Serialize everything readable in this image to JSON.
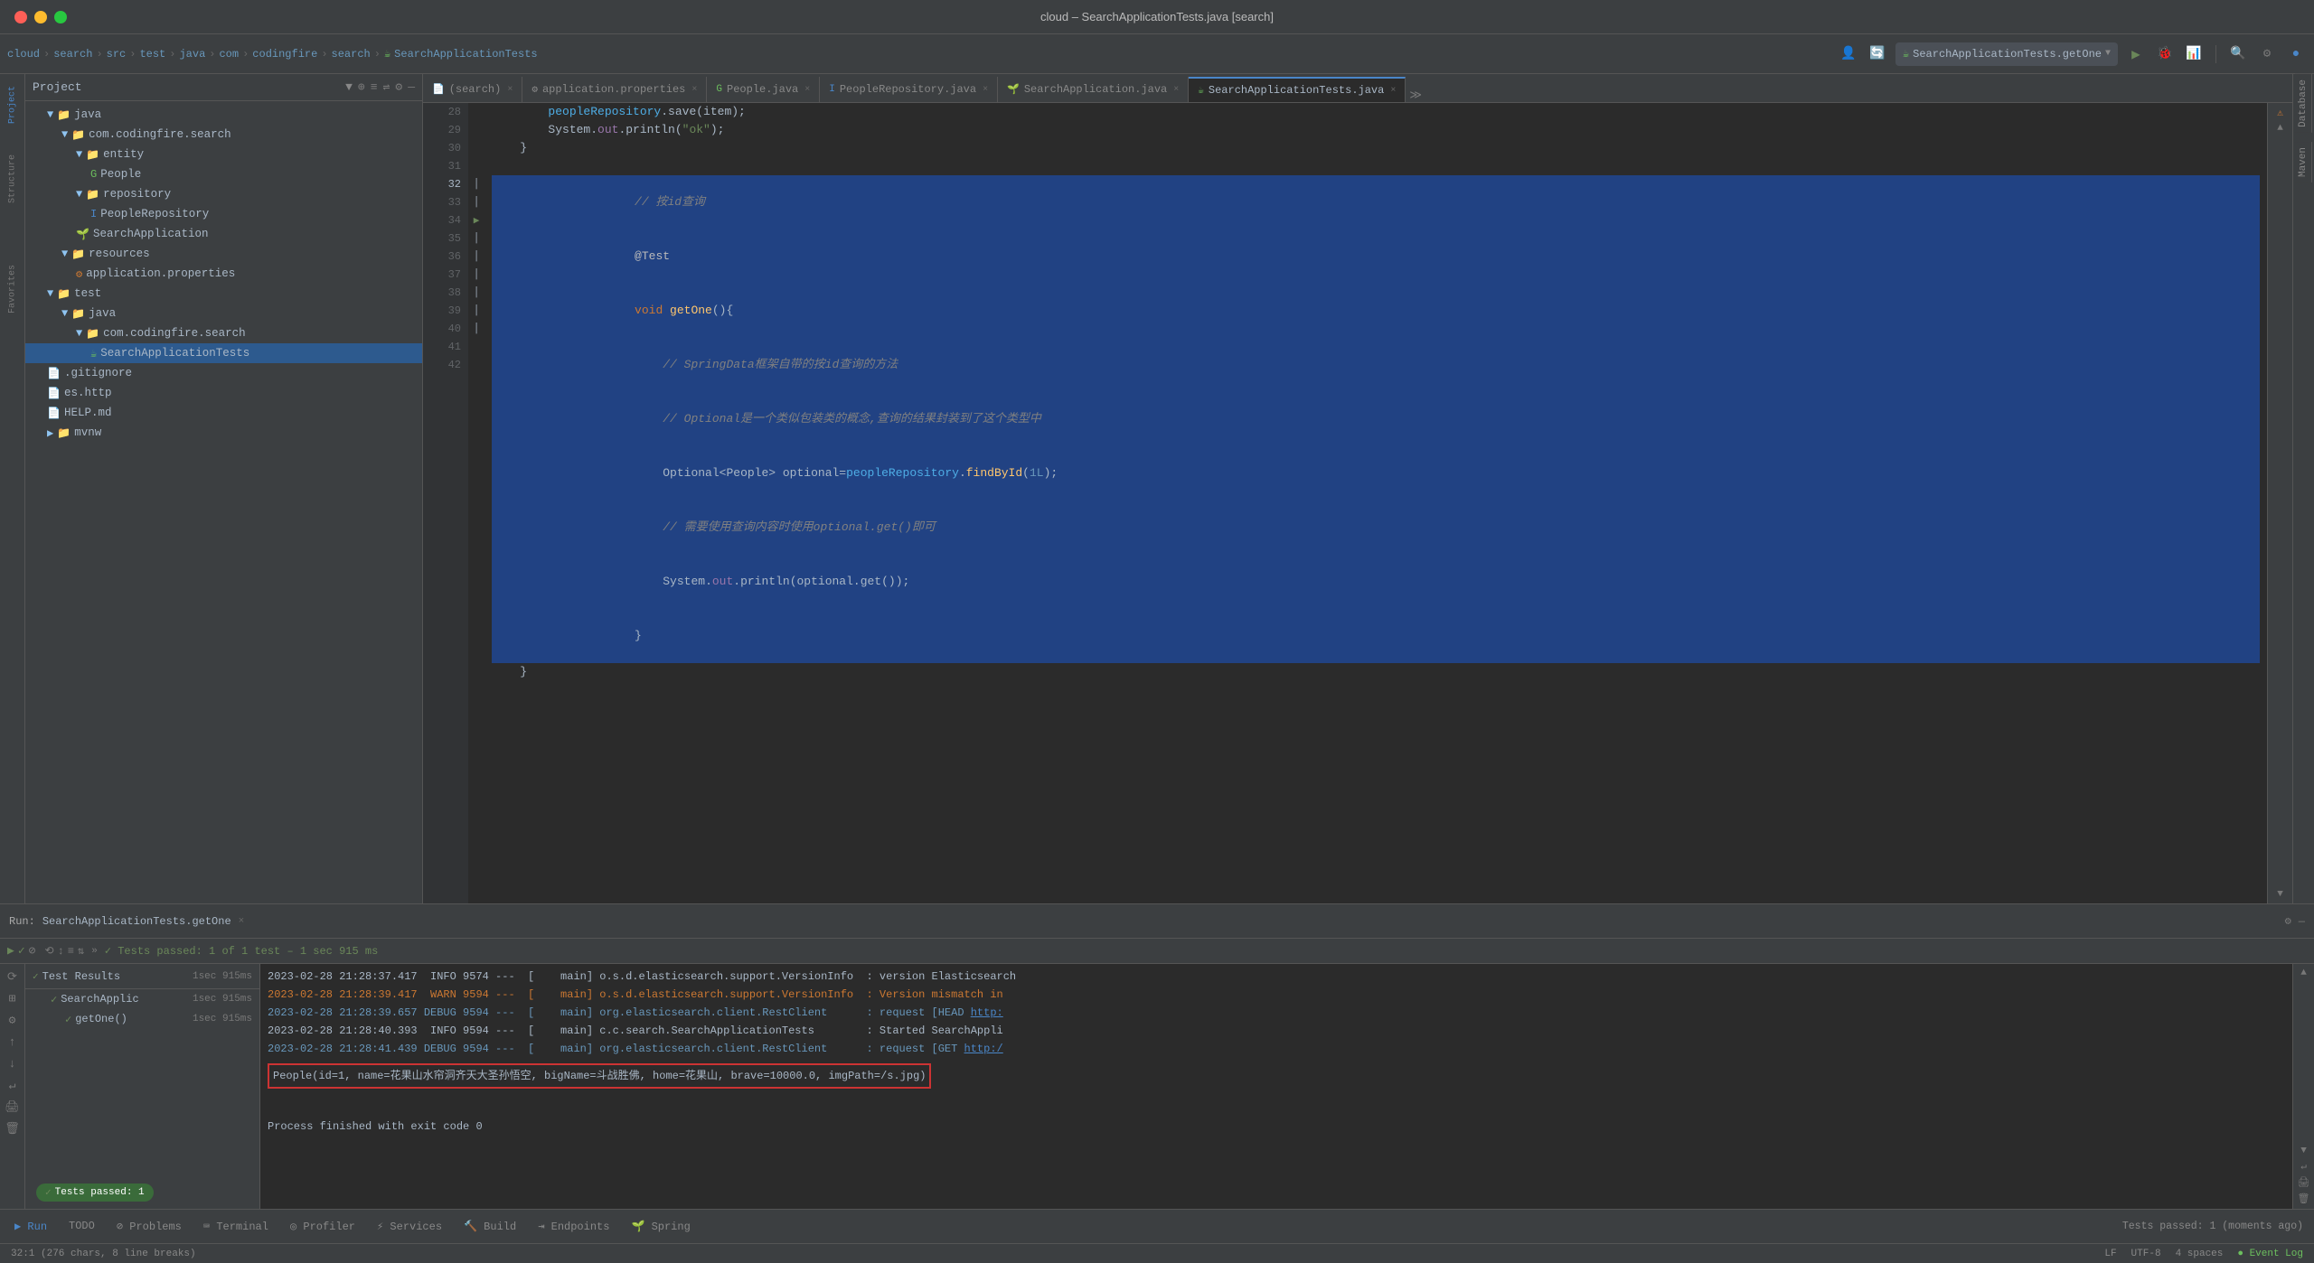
{
  "window": {
    "title": "cloud – SearchApplicationTests.java [search]"
  },
  "breadcrumb": {
    "items": [
      "cloud",
      "search",
      "src",
      "test",
      "java",
      "com",
      "codingfire",
      "search",
      "SearchApplicationTests"
    ]
  },
  "toolbar": {
    "run_config": "SearchApplicationTests.getOne",
    "run_label": "▶",
    "settings_label": "⚙"
  },
  "tabs": [
    {
      "label": "(search)",
      "icon": "📄",
      "active": false
    },
    {
      "label": "application.properties",
      "icon": "⚙",
      "active": false
    },
    {
      "label": "People.java",
      "icon": "☕",
      "active": false
    },
    {
      "label": "PeopleRepository.java",
      "icon": "🔵",
      "active": false
    },
    {
      "label": "SearchApplication.java",
      "icon": "🌱",
      "active": false
    },
    {
      "label": "SearchApplicationTests.java",
      "icon": "☕",
      "active": true
    }
  ],
  "code": {
    "lines": [
      {
        "num": 28,
        "text": "        peopleRepository.save(item);",
        "selected": false
      },
      {
        "num": 29,
        "text": "        System.out.println(\"ok\");",
        "selected": false
      },
      {
        "num": 30,
        "text": "    }",
        "selected": false
      },
      {
        "num": 31,
        "text": "",
        "selected": false
      },
      {
        "num": 32,
        "text": "        // 按id查询",
        "selected": true,
        "current": true
      },
      {
        "num": 33,
        "text": "        @Test",
        "selected": true
      },
      {
        "num": 34,
        "text": "        void getOne(){",
        "selected": true
      },
      {
        "num": 35,
        "text": "            // SpringData框架自带的按id查询的方法",
        "selected": true
      },
      {
        "num": 36,
        "text": "            // Optional是一个类似包装类的概念,查询的结果封装到了这个类型中",
        "selected": true
      },
      {
        "num": 37,
        "text": "            Optional<People> optional=peopleRepository.findById(1L);",
        "selected": true
      },
      {
        "num": 38,
        "text": "            // 需要使用查询内容时使用optional.get()即可",
        "selected": true
      },
      {
        "num": 39,
        "text": "            System.out.println(optional.get());",
        "selected": true
      },
      {
        "num": 40,
        "text": "        }",
        "selected": true
      },
      {
        "num": 41,
        "text": "    }",
        "selected": false
      },
      {
        "num": 42,
        "text": "",
        "selected": false
      }
    ]
  },
  "file_tree": {
    "items": [
      {
        "indent": 1,
        "type": "folder",
        "label": "java",
        "expanded": true
      },
      {
        "indent": 2,
        "type": "folder",
        "label": "com.codingfire.search",
        "expanded": true
      },
      {
        "indent": 3,
        "type": "folder",
        "label": "entity",
        "expanded": true
      },
      {
        "indent": 4,
        "type": "java-green",
        "label": "People"
      },
      {
        "indent": 3,
        "type": "folder",
        "label": "repository",
        "expanded": true
      },
      {
        "indent": 4,
        "type": "java-blue",
        "label": "PeopleRepository"
      },
      {
        "indent": 3,
        "type": "java-spring",
        "label": "SearchApplication"
      },
      {
        "indent": 2,
        "type": "folder",
        "label": "resources",
        "expanded": true
      },
      {
        "indent": 3,
        "type": "file-prop",
        "label": "application.properties"
      },
      {
        "indent": 1,
        "type": "folder",
        "label": "test",
        "expanded": true
      },
      {
        "indent": 2,
        "type": "folder",
        "label": "java",
        "expanded": true
      },
      {
        "indent": 3,
        "type": "folder",
        "label": "com.codingfire.search",
        "expanded": true
      },
      {
        "indent": 4,
        "type": "java-test",
        "label": "SearchApplicationTests",
        "selected": true
      },
      {
        "indent": 0,
        "type": "file",
        "label": ".gitignore"
      },
      {
        "indent": 0,
        "type": "file",
        "label": "es.http"
      },
      {
        "indent": 0,
        "type": "file",
        "label": "HELP.md"
      },
      {
        "indent": 0,
        "type": "folder",
        "label": "mvnw"
      }
    ]
  },
  "run_panel": {
    "title": "Run:",
    "tab": "SearchApplicationTests.getOne",
    "status_bar": {
      "check": "✓",
      "text": "Tests passed: 1 of 1 test – 1 sec 915 ms"
    },
    "test_results": {
      "header": "Test Results",
      "time": "1sec 915ms",
      "items": [
        {
          "label": "SearchApplic",
          "time": "1sec 915ms",
          "indent": 1
        },
        {
          "label": "getOne()",
          "time": "1sec 915ms",
          "indent": 2
        }
      ]
    },
    "console_lines": [
      {
        "text": "2023-02-28 21:28:37.417  INFO 9574 ---  [    main] o.s.d.elasticsearch.support.VersionInfo  : version Elasticsearch",
        "type": "info"
      },
      {
        "text": "2023-02-28 21:28:39.417  WARN 9594 ---  [    main] o.s.d.elasticsearch.support.VersionInfo  : Version mismatch in",
        "type": "warn"
      },
      {
        "text": "2023-02-28 21:28:39.657 DEBUG 9594 ---  [    main] org.elasticsearch.client.RestClient      : request [HEAD http:",
        "type": "debug"
      },
      {
        "text": "2023-02-28 21:28:40.393  INFO 9594 ---  [    main] c.c.search.SearchApplicationTests        : Started SearchAppli",
        "type": "info"
      },
      {
        "text": "2023-02-28 21:28:41.439 DEBUG 9594 ---  [    main] org.elasticsearch.client.RestClient      : request [GET http:/",
        "type": "debug"
      },
      {
        "text": "People(id=1, name=花果山水帘洞齐天大圣孙悟空, bigName=斗战胜佛, home=花果山, brave=10000.0, imgPath=/s.jpg)",
        "type": "highlighted"
      },
      {
        "text": "",
        "type": "blank"
      },
      {
        "text": "Process finished with exit code 0",
        "type": "exit"
      }
    ],
    "badge": "Tests passed: 1"
  },
  "bottom_tabs": [
    {
      "label": "▶ Run",
      "icon": "run"
    },
    {
      "label": "TODO",
      "icon": "todo"
    },
    {
      "label": "⊘ Problems",
      "icon": "problems"
    },
    {
      "label": "Terminal",
      "icon": "terminal"
    },
    {
      "label": "Profiler",
      "icon": "profiler"
    },
    {
      "label": "Services",
      "icon": "services"
    },
    {
      "label": "Build",
      "icon": "build"
    },
    {
      "label": "Endpoints",
      "icon": "endpoints"
    },
    {
      "label": "Spring",
      "icon": "spring"
    }
  ],
  "status_bar": {
    "left": "Tests passed: 1 (moments ago)",
    "position": "32:1 (276 chars, 8 line breaks)",
    "encoding": "LF",
    "charset": "UTF-8",
    "indent": "4 spaces"
  }
}
